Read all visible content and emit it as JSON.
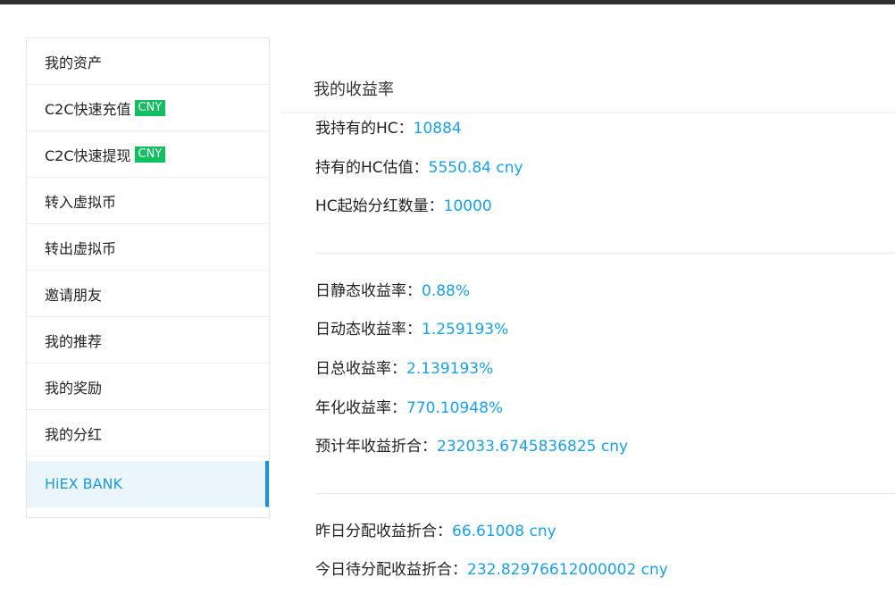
{
  "sidebar": {
    "items": [
      {
        "label": "我的资产",
        "badge": ""
      },
      {
        "label": "C2C快速充值",
        "badge": "CNY"
      },
      {
        "label": "C2C快速提现",
        "badge": "CNY"
      },
      {
        "label": "转入虚拟币",
        "badge": ""
      },
      {
        "label": "转出虚拟币",
        "badge": ""
      },
      {
        "label": "邀请朋友",
        "badge": ""
      },
      {
        "label": "我的推荐",
        "badge": ""
      },
      {
        "label": "我的奖励",
        "badge": ""
      },
      {
        "label": "我的分红",
        "badge": ""
      },
      {
        "label": "HiEX BANK",
        "badge": "",
        "active": true
      }
    ]
  },
  "main": {
    "title": "我的收益率",
    "holdings": {
      "hc_held_label": "我持有的HC：",
      "hc_held_value": "10884",
      "hc_value_label": "持有的HC估值：",
      "hc_value_value": "5550.84 cny",
      "hc_min_label": "HC起始分红数量：",
      "hc_min_value": "10000"
    },
    "rates": {
      "daily_static_label": "日静态收益率：",
      "daily_static_value": "0.88%",
      "daily_dynamic_label": "日动态收益率：",
      "daily_dynamic_value": "1.259193%",
      "daily_total_label": "日总收益率：",
      "daily_total_value": "2.139193%",
      "annual_label": "年化收益率：",
      "annual_value": "770.10948%",
      "projected_label": "预计年收益折合：",
      "projected_value": "232033.6745836825 cny"
    },
    "distribution": {
      "yesterday_label": "昨日分配收益折合：",
      "yesterday_value": "66.61008 cny",
      "today_label": "今日待分配收益折合：",
      "today_value": "232.82976612000002 cny"
    }
  },
  "colors": {
    "accent": "#1aa0e8",
    "badge": "#10c060",
    "active_bg": "#eaf5fc",
    "active_bar": "#1e90e0"
  }
}
